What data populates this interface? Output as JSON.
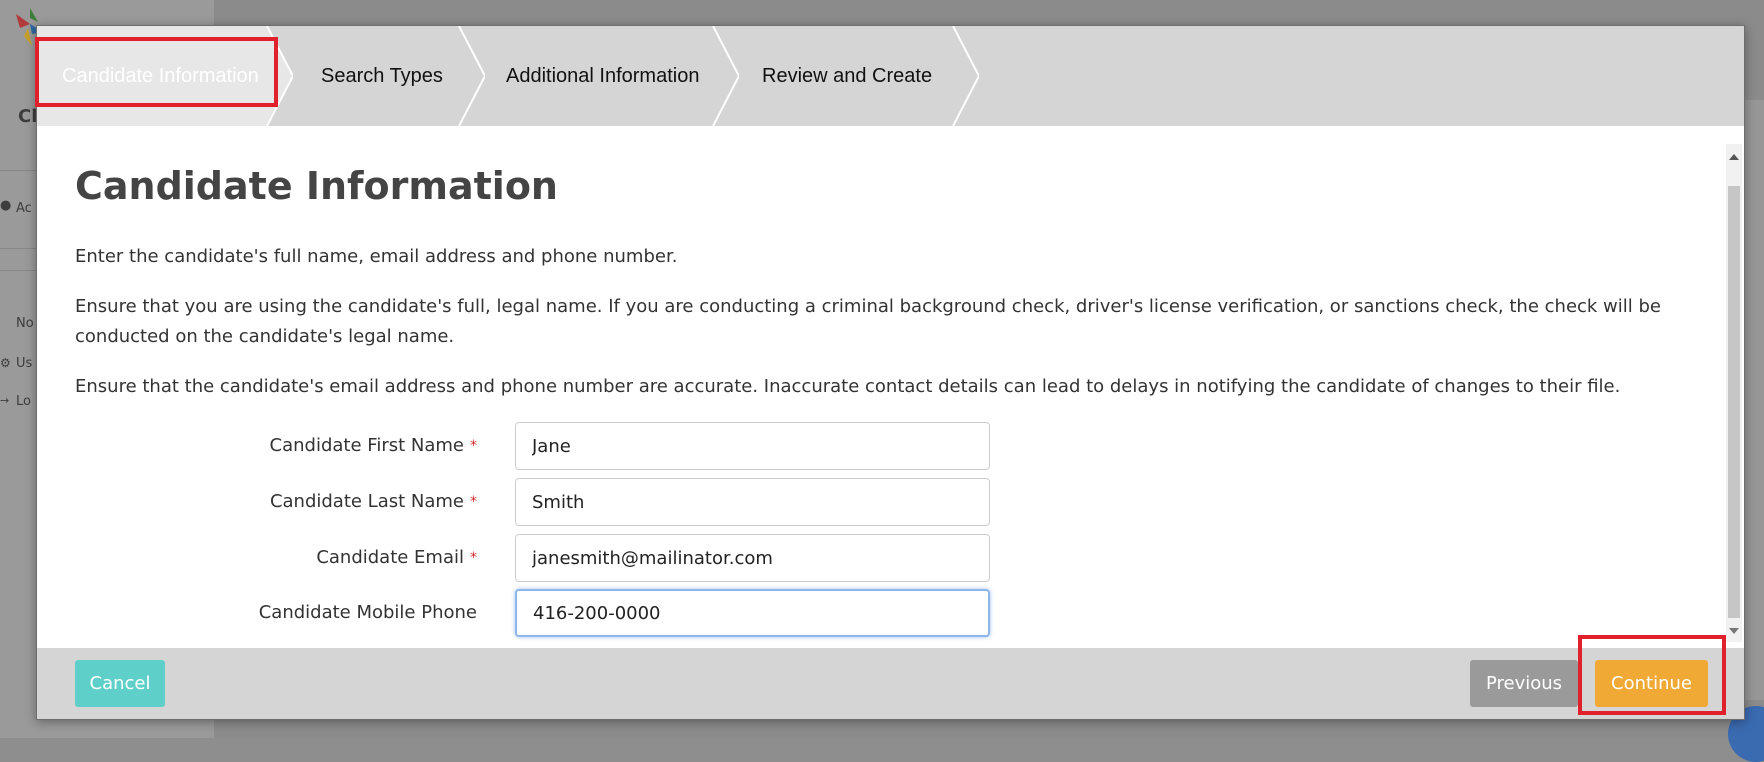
{
  "steps": [
    {
      "label": "Candidate Information",
      "active": true
    },
    {
      "label": "Search Types",
      "active": false
    },
    {
      "label": "Additional Information",
      "active": false
    },
    {
      "label": "Review and Create",
      "active": false
    }
  ],
  "content": {
    "title": "Candidate Information",
    "paragraphs": [
      "Enter the candidate's full name, email address and phone number.",
      "Ensure that you are using the candidate's full, legal name. If you are conducting a criminal background check, driver's license verification, or sanctions check, the check will be conducted on the candidate's legal name.",
      "Ensure that the candidate's email address and phone number are accurate. Inaccurate contact details can lead to delays in notifying the candidate of changes to their file."
    ]
  },
  "form": {
    "first_name": {
      "label": "Candidate First Name",
      "value": "Jane",
      "required": "*"
    },
    "last_name": {
      "label": "Candidate Last Name",
      "value": "Smith",
      "required": "*"
    },
    "email": {
      "label": "Candidate Email",
      "value": "janesmith@mailinator.com",
      "required": "*"
    },
    "phone": {
      "label": "Candidate Mobile Phone",
      "value": "416-200-0000"
    }
  },
  "footer": {
    "cancel_label": "Cancel",
    "previous_label": "Previous",
    "continue_label": "Continue"
  },
  "background": {
    "sidebar_partial_texts": [
      "Cl",
      "Ac",
      "No",
      "Us",
      "Lo"
    ]
  },
  "colors": {
    "accent_continue": "#f0a935",
    "accent_cancel": "#5ed0c9",
    "previous": "#9a9a9a",
    "highlight": "#e0202b",
    "required": "#d32f2f"
  },
  "icons": [
    "logo-icon",
    "user-icon",
    "gear-icon",
    "logout-icon",
    "scroll-up-icon",
    "scroll-down-icon"
  ]
}
